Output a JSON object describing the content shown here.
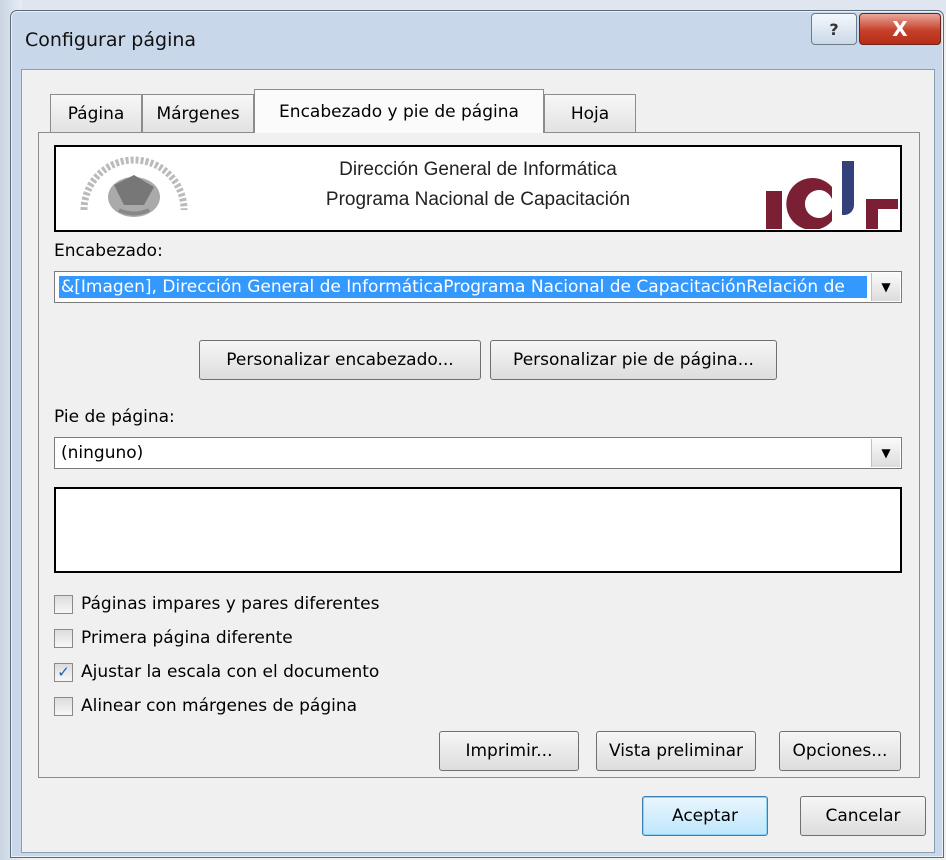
{
  "window": {
    "title": "Configurar página",
    "help_label": "?",
    "close_label": "X"
  },
  "tabs": [
    {
      "label": "Página"
    },
    {
      "label": "Márgenes"
    },
    {
      "label": "Encabezado y pie de página"
    },
    {
      "label": "Hoja"
    }
  ],
  "header_preview": {
    "line1": "Dirección General de Informática",
    "line2": "Programa Nacional de Capacitación"
  },
  "header": {
    "label": "Encabezado:",
    "value": "&[Imagen], Dirección General de InformáticaPrograma Nacional de CapacitaciónRelación de"
  },
  "buttons": {
    "custom_header": "Personalizar encabezado...",
    "custom_footer": "Personalizar pie de página...",
    "print": "Imprimir...",
    "preview": "Vista preliminar",
    "options": "Opciones...",
    "ok": "Aceptar",
    "cancel": "Cancelar"
  },
  "footer": {
    "label": "Pie de página:",
    "value": "(ninguno)"
  },
  "checkboxes": [
    {
      "label": "Páginas impares y pares diferentes",
      "checked": false
    },
    {
      "label": "Primera página diferente",
      "checked": false
    },
    {
      "label": "Ajustar la escala con el documento",
      "checked": true
    },
    {
      "label": "Alinear con márgenes de página",
      "checked": false
    }
  ],
  "colors": {
    "accent_selection": "#3399ff",
    "logo_red": "#7b1f35",
    "title_bar": "#c8d8ea"
  }
}
